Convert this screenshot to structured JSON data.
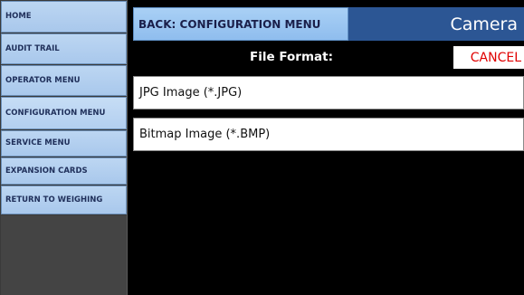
{
  "sidebar": {
    "items": [
      {
        "label": "HOME"
      },
      {
        "label": "AUDIT TRAIL"
      },
      {
        "label": "OPERATOR MENU"
      },
      {
        "label": "CONFIGURATION MENU"
      },
      {
        "label": "SERVICE MENU"
      },
      {
        "label": "EXPANSION CARDS"
      },
      {
        "label": "RETURN TO WEIGHING"
      }
    ]
  },
  "header": {
    "back_label": "BACK: CONFIGURATION MENU",
    "title": "Camera"
  },
  "subheader": {
    "label": "File Format:",
    "cancel_label": "CANCEL"
  },
  "options": [
    {
      "label": "JPG Image (*.JPG)"
    },
    {
      "label": "Bitmap Image (*.BMP)"
    }
  ],
  "colors": {
    "sidebar_button": "#b3cff0",
    "back_button": "#9cc6f2",
    "title_bar": "#2c5694",
    "cancel_text": "#e00000",
    "background": "#000000"
  }
}
